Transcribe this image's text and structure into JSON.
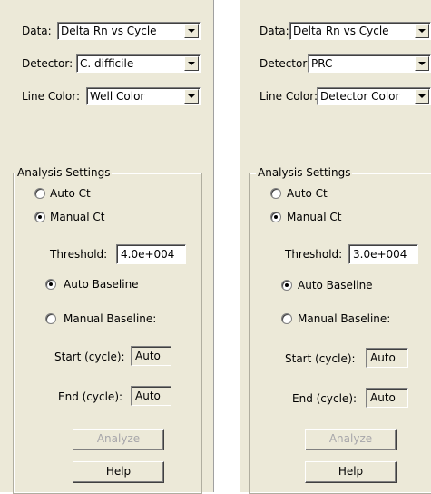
{
  "left": {
    "data_label": "Data:",
    "data_value": "Delta Rn vs Cycle",
    "detector_label": "Detector:",
    "detector_value": "C. difficile",
    "line_color_label": "Line Color:",
    "line_color_value": "Well Color",
    "group_title": "Analysis Settings",
    "auto_ct": "Auto Ct",
    "manual_ct": "Manual Ct",
    "threshold_label": "Threshold:",
    "threshold_value": "4.0e+004",
    "auto_baseline": "Auto Baseline",
    "manual_baseline": "Manual Baseline:",
    "start_label": "Start (cycle):",
    "start_value": "Auto",
    "end_label": "End (cycle):",
    "end_value": "Auto",
    "analyze_button": "Analyze",
    "help_button": "Help"
  },
  "right": {
    "data_label": "Data:",
    "data_value": "Delta Rn vs Cycle",
    "detector_label": "Detector:",
    "detector_value": "PRC",
    "line_color_label": "Line Color:",
    "line_color_value": "Detector Color",
    "group_title": "Analysis Settings",
    "auto_ct": "Auto Ct",
    "manual_ct": "Manual Ct",
    "threshold_label": "Threshold:",
    "threshold_value": "3.0e+004",
    "auto_baseline": "Auto Baseline",
    "manual_baseline": "Manual Baseline:",
    "start_label": "Start (cycle):",
    "start_value": "Auto",
    "end_label": "End (cycle):",
    "end_value": "Auto",
    "analyze_button": "Analyze",
    "help_button": "Help"
  },
  "selection": {
    "ct_mode": "manual",
    "baseline_mode": "auto"
  },
  "colors": {
    "panel_background": "#ece9d8",
    "disabled_text": "#a7a6aa"
  }
}
